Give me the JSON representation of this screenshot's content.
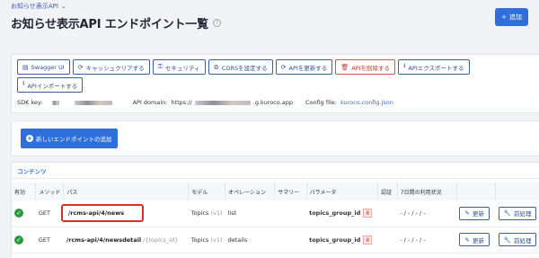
{
  "breadcrumb": {
    "label": "お知らせ表示API"
  },
  "page": {
    "title": "お知らせ表示API エンドポイント一覧",
    "help": "?"
  },
  "header": {
    "add_label": "追加"
  },
  "toolbar": {
    "buttons": [
      {
        "label": "Swagger UI",
        "icon": "file-icon"
      },
      {
        "label": "キャッシュクリアする",
        "icon": "refresh-icon"
      },
      {
        "label": "セキュリティ",
        "icon": "key-icon"
      },
      {
        "label": "CORSを設定する",
        "icon": "gear-icon"
      },
      {
        "label": "APIを更新する",
        "icon": "refresh-icon"
      },
      {
        "label": "APIを削除する",
        "icon": "trash-icon"
      },
      {
        "label": "APIエクスポートする",
        "icon": "download-icon"
      },
      {
        "label": "APIインポートする",
        "icon": "upload-icon"
      }
    ]
  },
  "sdk": {
    "sdk_key_label": "SDK key:",
    "domain_label": "API domain:",
    "domain_prefix": "https://",
    "domain_suffix": ".g.kuroco.app",
    "config_label": "Config file:",
    "config_file": "kuroco.config.json"
  },
  "new_endpoint": {
    "label": "新しいエンドポイントの追加"
  },
  "contents": {
    "section_title": "コンテンツ",
    "columns": [
      "有効",
      "メソッド",
      "パス",
      "モデル",
      "オペレーション",
      "サマリー",
      "パラメータ",
      "認証",
      "7日間の利用状況",
      "",
      ""
    ],
    "rows": [
      {
        "enabled": true,
        "method": "GET",
        "path": "/rcms-api/4/news",
        "path_sub": "",
        "model": "Topics",
        "model_version": "(v1)",
        "operation": "list",
        "summary": "",
        "param": "topics_group_id",
        "param_value": "8",
        "auth": "",
        "usage": "- / - / - / -",
        "update_label": "更新",
        "pre_label": "前処理"
      },
      {
        "enabled": true,
        "method": "GET",
        "path": "/rcms-api/4/newsdetail",
        "path_sub": "/{topics_id}",
        "model": "Topics",
        "model_version": "(v1)",
        "operation": "details",
        "summary": "",
        "param": "topics_group_id",
        "param_value": "8",
        "auth": "",
        "usage": "- / - / - / -",
        "update_label": "更新",
        "pre_label": "前処理"
      }
    ]
  }
}
